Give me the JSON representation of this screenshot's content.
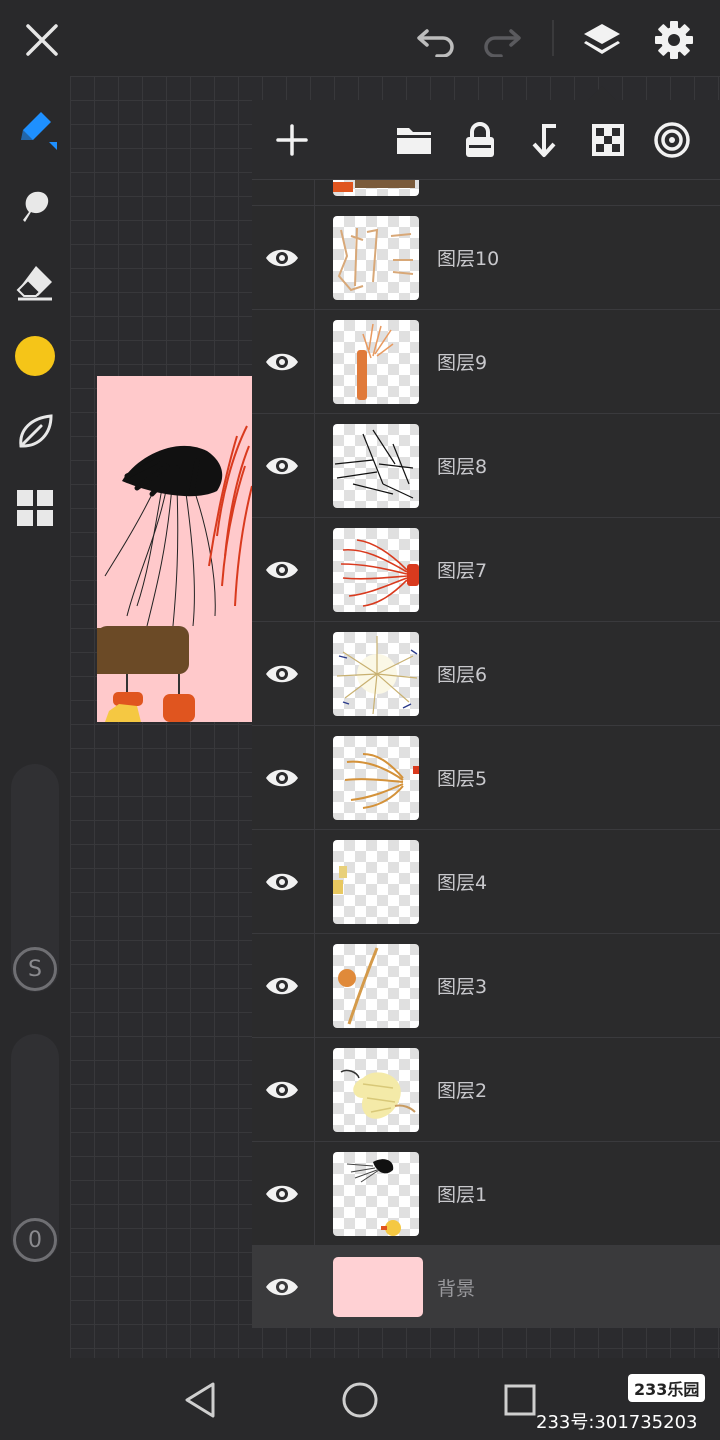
{
  "accent_color": "#1e90ff",
  "current_color": "#f5c518",
  "top_bar": {
    "icons": [
      "close-icon",
      "undo-icon",
      "redo-icon",
      "layers-icon",
      "settings-icon"
    ]
  },
  "left_toolbar": {
    "icons": [
      "brush-icon",
      "smudge-icon",
      "eraser-icon",
      "color-swatch",
      "leaf-icon",
      "grid-icon"
    ],
    "size_label": "S",
    "opacity_label": "0"
  },
  "layers_panel": {
    "toolbar_icons": [
      "add-layer-icon",
      "folder-icon",
      "lock-icon",
      "merge-down-icon",
      "transparency-icon",
      "blend-mode-icon"
    ],
    "layers": [
      {
        "name": "图层10",
        "visible": true
      },
      {
        "name": "图层9",
        "visible": true
      },
      {
        "name": "图层8",
        "visible": true
      },
      {
        "name": "图层7",
        "visible": true
      },
      {
        "name": "图层6",
        "visible": true
      },
      {
        "name": "图层5",
        "visible": true
      },
      {
        "name": "图层4",
        "visible": true
      },
      {
        "name": "图层3",
        "visible": true
      },
      {
        "name": "图层2",
        "visible": true
      },
      {
        "name": "图层1",
        "visible": true
      }
    ],
    "background_layer": {
      "name": "背景",
      "visible": true,
      "color": "#ffd1d4"
    }
  },
  "navbar": {
    "icons": [
      "back-icon",
      "home-icon",
      "recents-icon"
    ]
  },
  "watermark": {
    "logo": "233乐园",
    "text": "233号:301735203"
  }
}
